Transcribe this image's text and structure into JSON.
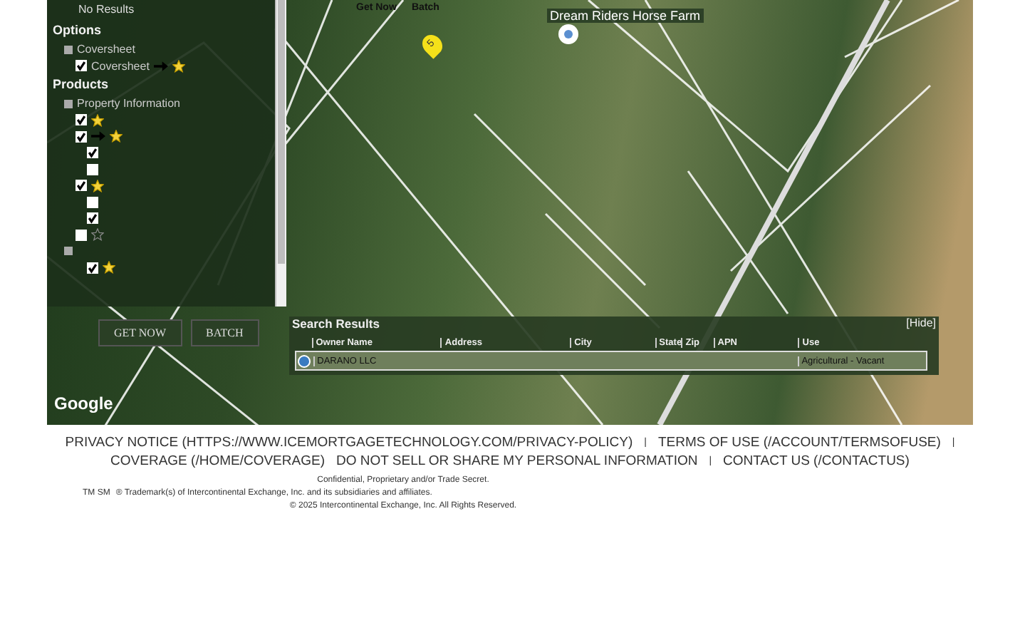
{
  "panel": {
    "no_results": "No Results",
    "options_title": "Options",
    "options": [
      {
        "kind": "group",
        "label": "Coversheet",
        "checked": false,
        "arrow": false,
        "star": false
      },
      {
        "kind": "item",
        "label": "Coversheet",
        "checked": true,
        "arrow": true,
        "star": true,
        "favorite": true
      }
    ],
    "products_title": "Products",
    "products": [
      {
        "kind": "group",
        "label": "Property Information",
        "checked": false,
        "arrow": false,
        "star": false
      },
      {
        "kind": "item",
        "checked": true,
        "arrow": false,
        "star": true,
        "favorite": true
      },
      {
        "kind": "item",
        "checked": true,
        "arrow": true,
        "star": true,
        "favorite": true
      },
      {
        "kind": "subitem",
        "checked": true,
        "arrow": false,
        "star": false
      },
      {
        "kind": "subitem",
        "checked": false,
        "arrow": false,
        "star": false
      },
      {
        "kind": "item",
        "checked": true,
        "arrow": false,
        "star": true,
        "favorite": true
      },
      {
        "kind": "subitem",
        "checked": false,
        "arrow": false,
        "star": false
      },
      {
        "kind": "subitem",
        "checked": true,
        "arrow": false,
        "star": false
      },
      {
        "kind": "item",
        "checked": false,
        "arrow": false,
        "star": true,
        "favorite": false
      },
      {
        "kind": "group",
        "checked": false,
        "arrow": false,
        "star": false
      },
      {
        "kind": "subitem",
        "checked": true,
        "arrow": false,
        "star": true,
        "favorite": true
      }
    ],
    "buttons": [
      "GET NOW",
      "BATCH"
    ]
  },
  "map": {
    "top_labels": [
      "Get Now",
      "Batch"
    ],
    "marker": "5",
    "place_label": "Dream Riders Horse Farm",
    "logo": "Google"
  },
  "results": {
    "title": "Search Results",
    "hide": "[Hide]",
    "columns": [
      "Owner Name",
      "Address",
      "City",
      "State",
      "Zip",
      "APN",
      "Use"
    ],
    "rows": [
      {
        "selected": true,
        "cells": [
          "DARANO LLC",
          "",
          "",
          "",
          "",
          "",
          "Agricultural - Vacant"
        ]
      }
    ]
  },
  "footer": {
    "links": [
      {
        "text": "PRIVACY NOTICE (HTTPS://WWW.ICEMORTGAGETECHNOLOGY.COM/PRIVACY-POLICY)"
      },
      {
        "text": "TERMS OF USE (/ACCOUNT/TERMSOFUSE)"
      },
      {
        "text": "COVERAGE (/HOME/COVERAGE)"
      },
      {
        "text": "DO NOT SELL OR SHARE MY PERSONAL INFORMATION"
      },
      {
        "text": "CONTACT US (/CONTACTUS)"
      }
    ],
    "separator": "|",
    "confidential": "Confidential, Proprietary and/or Trade Secret.",
    "trademark_marks": "TM SM",
    "trademark": "® Trademark(s) of Intercontinental Exchange, Inc. and its subsidiaries and affiliates.",
    "copyright": "© 2025 Intercontinental Exchange, Inc. All Rights Reserved."
  }
}
